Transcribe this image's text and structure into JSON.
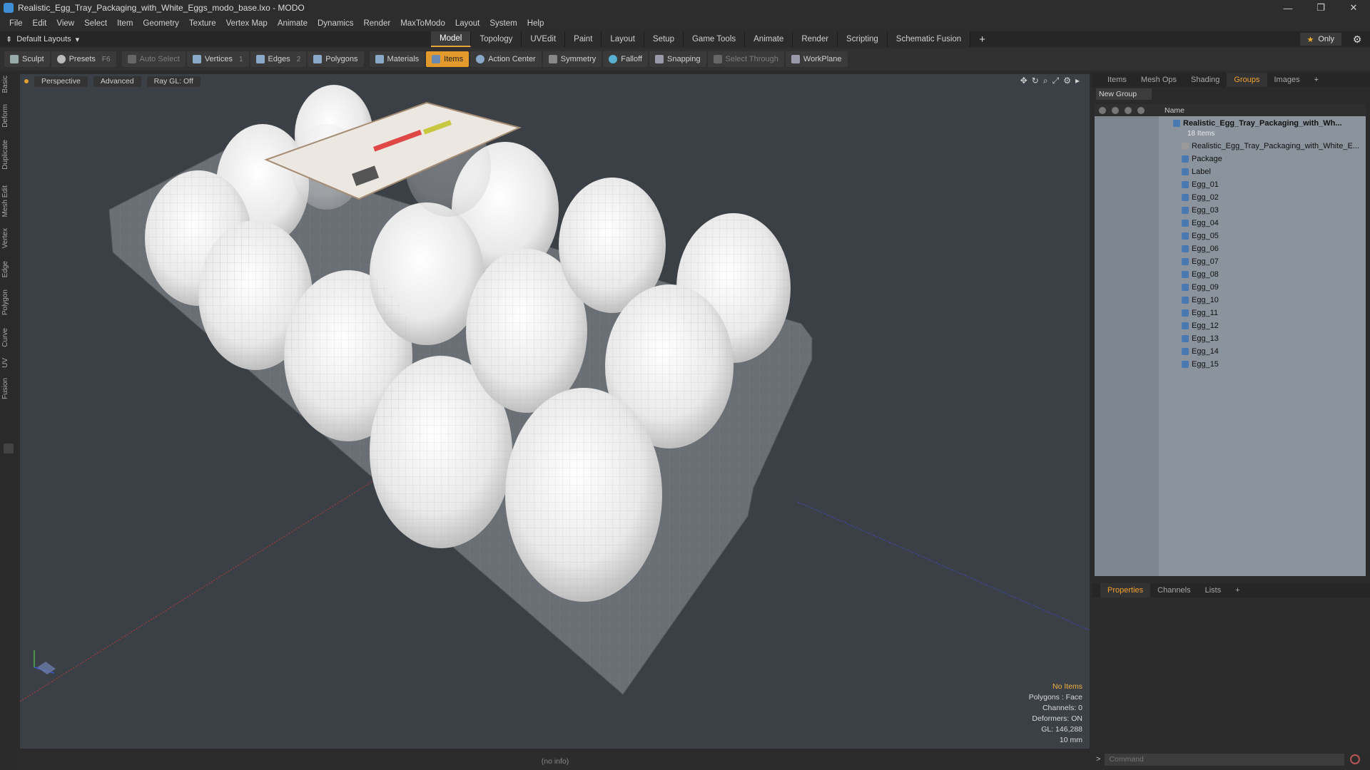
{
  "window": {
    "title": "Realistic_Egg_Tray_Packaging_with_White_Eggs_modo_base.lxo - MODO",
    "min": "—",
    "restore": "❐",
    "close": "✕"
  },
  "menu": [
    "File",
    "Edit",
    "View",
    "Select",
    "Item",
    "Geometry",
    "Texture",
    "Vertex Map",
    "Animate",
    "Dynamics",
    "Render",
    "MaxToModo",
    "Layout",
    "System",
    "Help"
  ],
  "layout_selector": "Default Layouts",
  "top_tabs": [
    "Model",
    "Topology",
    "UVEdit",
    "Paint",
    "Layout",
    "Setup",
    "Game Tools",
    "Animate",
    "Render",
    "Scripting",
    "Schematic Fusion"
  ],
  "top_tabs_active": "Model",
  "only_label": "Only",
  "toolbar": {
    "sculpt": "Sculpt",
    "presets": "Presets",
    "presets_key": "F6",
    "auto_select": "Auto Select",
    "vertices": "Vertices",
    "vertices_key": "1",
    "edges": "Edges",
    "edges_key": "2",
    "polygons": "Polygons",
    "materials": "Materials",
    "items": "Items",
    "action_center": "Action Center",
    "symmetry": "Symmetry",
    "falloff": "Falloff",
    "snapping": "Snapping",
    "select_through": "Select Through",
    "workplane": "WorkPlane"
  },
  "left_tabs": [
    "Basic",
    "Deform",
    "Duplicate",
    "Mesh Edit",
    "Vertex",
    "Edge",
    "Polygon",
    "Curve",
    "UV",
    "Fusion"
  ],
  "viewport": {
    "perspective": "Perspective",
    "advanced": "Advanced",
    "raygl": "Ray GL: Off",
    "info": {
      "no_items": "No Items",
      "polygons": "Polygons : Face",
      "channels": "Channels: 0",
      "deformers": "Deformers: ON",
      "gl": "GL: 146,288",
      "scale": "10 mm"
    },
    "status": "(no info)"
  },
  "right_tabs": [
    "Items",
    "Mesh Ops",
    "Shading",
    "Groups",
    "Images"
  ],
  "right_tabs_active": "Groups",
  "new_group": "New Group",
  "tree": {
    "col_name": "Name",
    "root": "Realistic_Egg_Tray_Packaging_with_Wh...",
    "root_count": "18 Items",
    "children": [
      "Realistic_Egg_Tray_Packaging_with_White_E...",
      "Package",
      "Label",
      "Egg_01",
      "Egg_02",
      "Egg_03",
      "Egg_04",
      "Egg_05",
      "Egg_06",
      "Egg_07",
      "Egg_08",
      "Egg_09",
      "Egg_10",
      "Egg_11",
      "Egg_12",
      "Egg_13",
      "Egg_14",
      "Egg_15"
    ]
  },
  "prop_tabs": [
    "Properties",
    "Channels",
    "Lists"
  ],
  "prop_tabs_active": "Properties",
  "command_placeholder": "Command",
  "colors": {
    "accent": "#e39a2d",
    "viewport_bg": "#3b4046",
    "tree_bg": "#8b949d"
  }
}
